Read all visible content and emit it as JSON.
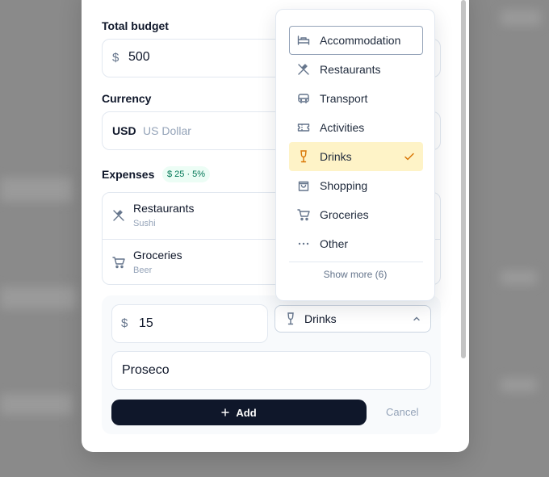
{
  "budget": {
    "label": "Total budget",
    "symbol": "$",
    "value": "500"
  },
  "currency": {
    "label": "Currency",
    "code": "USD",
    "name": "US Dollar"
  },
  "expenses": {
    "label": "Expenses",
    "badge": "$ 25 · 5%",
    "items": [
      {
        "title": "Restaurants",
        "subtitle": "Sushi",
        "icon": "utensils-icon"
      },
      {
        "title": "Groceries",
        "subtitle": "Beer",
        "icon": "cart-icon"
      }
    ]
  },
  "form": {
    "symbol": "$",
    "amount": "15",
    "category": "Drinks",
    "note": "Proseco",
    "add_label": "Add",
    "cancel_label": "Cancel"
  },
  "dropdown": {
    "items": [
      {
        "label": "Accommodation",
        "icon": "bed-icon"
      },
      {
        "label": "Restaurants",
        "icon": "utensils-icon"
      },
      {
        "label": "Transport",
        "icon": "bus-icon"
      },
      {
        "label": "Activities",
        "icon": "ticket-icon"
      },
      {
        "label": "Drinks",
        "icon": "wine-icon",
        "selected": true
      },
      {
        "label": "Shopping",
        "icon": "bag-icon"
      },
      {
        "label": "Groceries",
        "icon": "cart-icon"
      },
      {
        "label": "Other",
        "icon": "dots-icon"
      }
    ],
    "show_more": "Show more (6)"
  },
  "colors": {
    "accent": "#0f172a",
    "selected_bg": "#fef3c7",
    "selected_icon": "#d97706",
    "badge_bg": "#ecfdf5",
    "badge_text": "#047857"
  }
}
